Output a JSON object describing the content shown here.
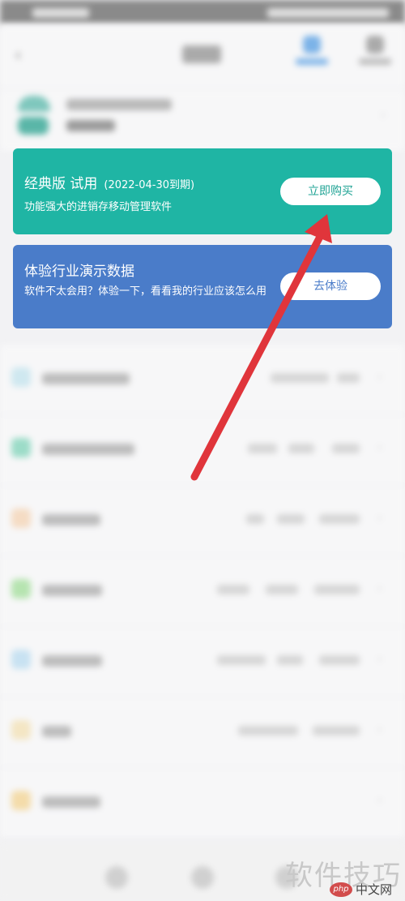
{
  "colors": {
    "teal_card": "#1fb5a4",
    "blue_card": "#4a7cc9",
    "arrow": "#e0353b",
    "background": "#f2f2f4"
  },
  "nav": {
    "back_icon": "back-arrow-icon"
  },
  "trial_card": {
    "title": "经典版 试用",
    "expiry": "(2022-04-30到期)",
    "description": "功能强大的进销存移动管理软件",
    "button_label": "立即购买"
  },
  "demo_card": {
    "title": "体验行业演示数据",
    "description": "软件不太会用？体验一下，看看我的行业应该怎么用",
    "button_label": "去体验"
  },
  "watermark": {
    "signature": "软件技巧",
    "site_logo": "php",
    "site_text": "中文网"
  }
}
